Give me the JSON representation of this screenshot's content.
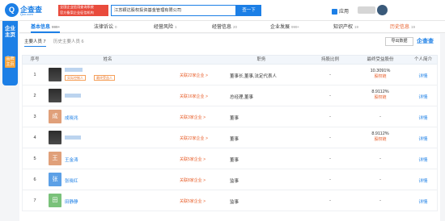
{
  "brand": {
    "logo_char": "Q",
    "name": "企查查",
    "url": "Qcc.com"
  },
  "tagline": {
    "line1": "全国企业信用查询系统",
    "line2": "官方备案企业征信机构"
  },
  "search": {
    "value": "江苏颖达股权投资基金管理有限公司",
    "button": "查一下"
  },
  "header_right": {
    "app_label": "应用"
  },
  "side_nav": {
    "main": "企业主页",
    "sub": "品牌主页"
  },
  "tabs": [
    {
      "label": "基本信息",
      "count": "999+"
    },
    {
      "label": "法律诉讼",
      "count": "0"
    },
    {
      "label": "经营风险",
      "count": "1"
    },
    {
      "label": "经营信息",
      "count": "20"
    },
    {
      "label": "企业发展",
      "count": "999+"
    },
    {
      "label": "知识产权",
      "count": "19"
    },
    {
      "label": "历史信息",
      "count": "19"
    }
  ],
  "subtabs": {
    "active": "主要人员 7",
    "inactive": "历史主要人员 6"
  },
  "toolbar": {
    "export": "导出数据",
    "brand_mark": "企查查"
  },
  "columns": [
    "序号",
    "姓名",
    "职务",
    "持股比例",
    "最终受益股份",
    "个人简介"
  ],
  "rows": [
    {
      "idx": "1",
      "avatar": "",
      "name": "",
      "badges": [
        "实际控制人",
        "最终受益人"
      ],
      "assoc": "关联22家企业 >",
      "role": "董事长,董事,法定代表人",
      "ratio": "-",
      "final": "10.3091%",
      "final_link": "股权链",
      "detail": "详情"
    },
    {
      "idx": "2",
      "avatar": "",
      "name": "",
      "badges": [],
      "assoc": "关联16家企业 >",
      "role": "总经理,董事",
      "ratio": "-",
      "final": "8.9112%",
      "final_link": "股权链",
      "detail": "详情"
    },
    {
      "idx": "3",
      "avatar": "成",
      "name": "成晓兆",
      "badges": [],
      "assoc": "关联3家企业 >",
      "role": "董事",
      "ratio": "-",
      "final": "-",
      "final_link": "",
      "detail": "详情"
    },
    {
      "idx": "4",
      "avatar": "",
      "name": "",
      "badges": [],
      "assoc": "关联22家企业 >",
      "role": "董事",
      "ratio": "-",
      "final": "8.9112%",
      "final_link": "股权链",
      "detail": "详情"
    },
    {
      "idx": "5",
      "avatar": "王",
      "name": "王金涛",
      "badges": [],
      "assoc": "关联5家企业 >",
      "role": "董事",
      "ratio": "-",
      "final": "-",
      "final_link": "",
      "detail": "详情"
    },
    {
      "idx": "6",
      "avatar": "张",
      "name": "张晓红",
      "badges": [],
      "assoc": "关联8家企业 >",
      "role": "监事",
      "ratio": "-",
      "final": "-",
      "final_link": "",
      "detail": "详情"
    },
    {
      "idx": "7",
      "avatar": "田",
      "name": "田静静",
      "badges": [],
      "assoc": "关联5家企业 >",
      "role": "监事",
      "ratio": "-",
      "final": "-",
      "final_link": "",
      "detail": "详情"
    }
  ],
  "colors": {
    "accent": "#1c7fe6",
    "warn": "#e8602c",
    "avatar_a": "#e0a07a",
    "avatar_b": "#5ca0e6",
    "avatar_c": "#e6b35c",
    "avatar_d": "#7ac27a"
  }
}
